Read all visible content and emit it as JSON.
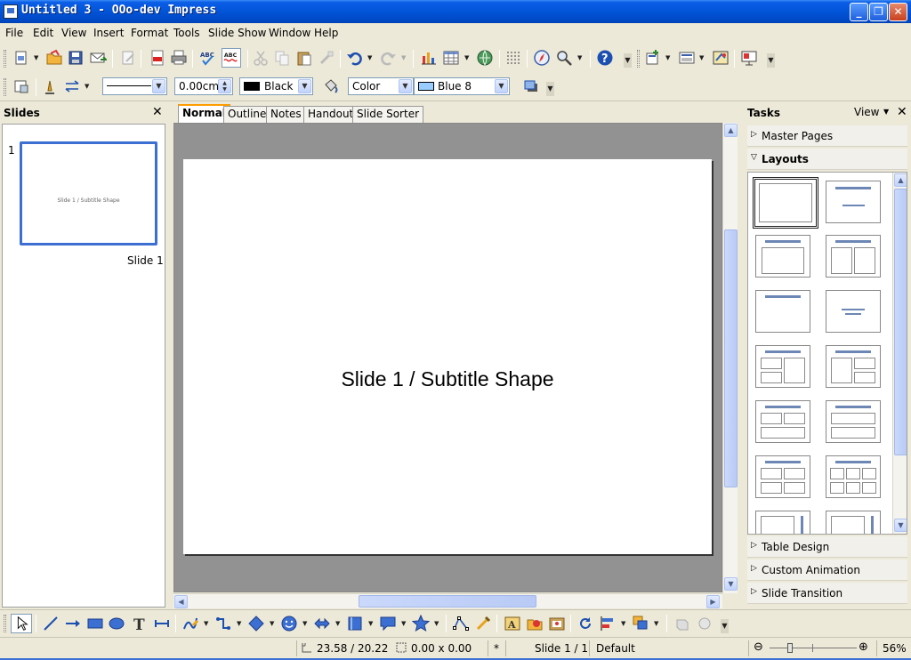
{
  "window": {
    "title": "Untitled 3 - OOo-dev Impress",
    "min_glyph": "_",
    "max_glyph": "❐",
    "close_glyph": "✕"
  },
  "menu": [
    "File",
    "Edit",
    "View",
    "Insert",
    "Format",
    "Tools",
    "Slide Show",
    "Window",
    "Help"
  ],
  "line_format_toolbar": {
    "line_width": "0.00cm",
    "line_color": "Black",
    "area_style": "Color",
    "area_color": "Blue 8"
  },
  "slides_pane": {
    "title": "Slides",
    "close_glyph": "✕",
    "slides": [
      {
        "number": "1",
        "thumb_text": "Slide 1 / Subtitle Shape",
        "caption": "Slide 1"
      }
    ]
  },
  "view_tabs": [
    "Normal",
    "Outline",
    "Notes",
    "Handout",
    "Slide Sorter"
  ],
  "active_tab": "Normal",
  "slide": {
    "subtitle": "Slide 1 / Subtitle Shape"
  },
  "tasks_pane": {
    "title": "Tasks",
    "view_label": "View",
    "close_glyph": "✕",
    "sections": {
      "master_pages": "Master Pages",
      "layouts": "Layouts",
      "table_design": "Table Design",
      "custom_animation": "Custom Animation",
      "slide_transition": "Slide Transition"
    }
  },
  "status_bar": {
    "position": "23.58 / 20.22",
    "size": "0.00 x 0.00",
    "modified": "*",
    "slide": "Slide 1 / 1",
    "layout": "Default",
    "zoom": "56%",
    "zoom_minus": "⊖",
    "zoom_plus": "⊕"
  },
  "colors": {
    "titlebar": "#0254d8",
    "accent": "#3c6fd1",
    "canvas_bg": "#929292",
    "line_color_swatch": "#000000",
    "area_color_swatch": "#99ccff"
  }
}
